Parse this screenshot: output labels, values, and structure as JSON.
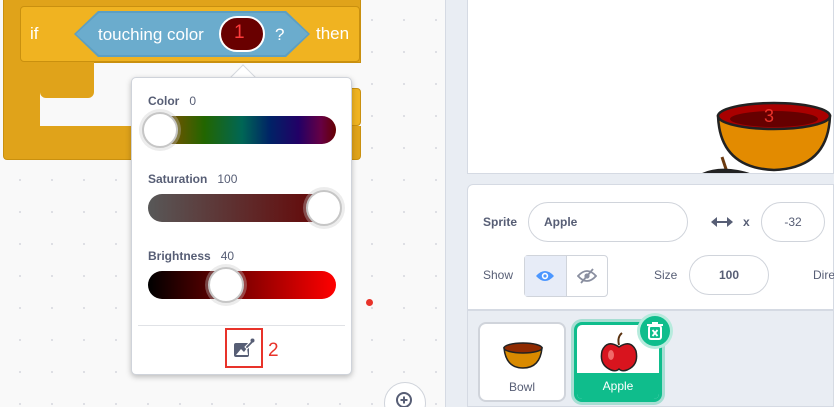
{
  "code_block": {
    "if_label": "if",
    "condition_label": "touching color",
    "question_mark": "?",
    "then_label": "then",
    "swatch_color": "#690000",
    "swatch_marker": "1"
  },
  "color_popover": {
    "color": {
      "label": "Color",
      "value": "0",
      "level_percent": 0
    },
    "saturation": {
      "label": "Saturation",
      "value": "100",
      "level_percent": 100
    },
    "brightness": {
      "label": "Brightness",
      "value": "40",
      "level_percent": 40
    },
    "eyedropper_icon": "eyedropper-icon",
    "eyedropper_marker": "2"
  },
  "stage": {
    "bowl_marker": "3"
  },
  "sprite_info": {
    "sprite_label": "Sprite",
    "sprite_name": "Apple",
    "x_icon": "horizontal-arrows-icon",
    "x_label": "x",
    "x_value": "-32",
    "show_label": "Show",
    "visible_icon": "eye-icon",
    "hidden_icon": "eye-slash-icon",
    "size_label": "Size",
    "size_value": "100",
    "direction_label": "Dire"
  },
  "sprites": [
    {
      "name": "Bowl",
      "selected": false
    },
    {
      "name": "Apple",
      "selected": true
    }
  ],
  "delete_icon": "trash-icon",
  "zoom_icon": "zoom-in-icon",
  "colors": {
    "block_orange": "#f0b321",
    "sensing_blue": "#5d9fc2",
    "selected_green": "#0fbd8c",
    "annotation_red": "#e8332a"
  }
}
